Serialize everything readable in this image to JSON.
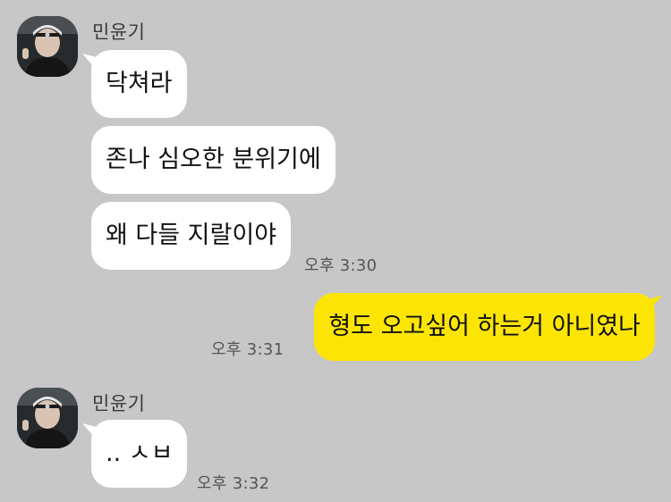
{
  "chat": {
    "colors": {
      "background": "#c7c7c7",
      "incoming_bubble": "#ffffff",
      "outgoing_bubble": "#fce504"
    },
    "groups": [
      {
        "sender": "민윤기",
        "messages": [
          "닥쳐라",
          "존나 심오한 분위기에",
          "왜 다들 지랄이야"
        ],
        "time": "오후 3:30"
      },
      {
        "outgoing": true,
        "messages": [
          "형도 오고싶어 하는거 아니였나"
        ],
        "time": "오후 3:31"
      },
      {
        "sender": "민윤기",
        "messages": [
          ".. ㅅㅂ"
        ],
        "time": "오후 3:32"
      }
    ]
  }
}
